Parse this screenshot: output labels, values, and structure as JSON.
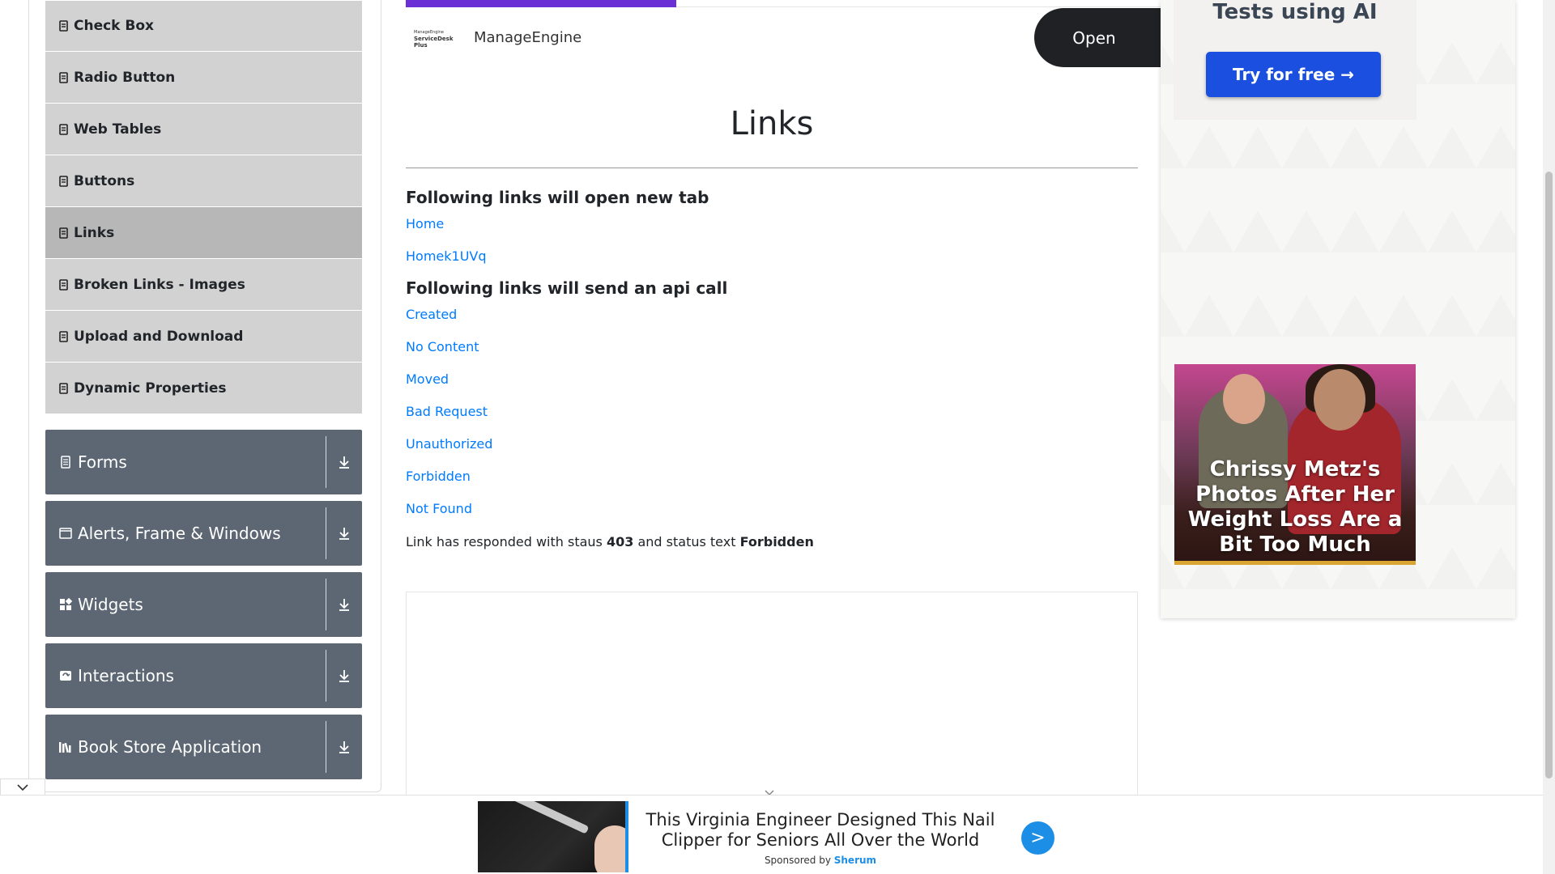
{
  "sidebar": {
    "elements_items": [
      {
        "label": "Check Box"
      },
      {
        "label": "Radio Button"
      },
      {
        "label": "Web Tables"
      },
      {
        "label": "Buttons"
      },
      {
        "label": "Links",
        "active": true
      },
      {
        "label": "Broken Links - Images"
      },
      {
        "label": "Upload and Download"
      },
      {
        "label": "Dynamic Properties"
      }
    ],
    "groups": [
      {
        "label": "Forms",
        "icon": "form-icon"
      },
      {
        "label": "Alerts, Frame & Windows",
        "icon": "window-icon"
      },
      {
        "label": "Widgets",
        "icon": "widgets-icon"
      },
      {
        "label": "Interactions",
        "icon": "interactions-icon"
      },
      {
        "label": "Book Store Application",
        "icon": "book-icon"
      }
    ]
  },
  "top_ad": {
    "logo_line1": "ManageEngine",
    "logo_line2": "ServiceDesk Plus",
    "brand": "ManageEngine",
    "open_label": "Open"
  },
  "main": {
    "title": "Links",
    "new_tab_heading": "Following links will open new tab",
    "new_tab_links": [
      "Home",
      "Homek1UVq"
    ],
    "api_heading": "Following links will send an api call",
    "api_links": [
      "Created",
      "No Content",
      "Moved",
      "Bad Request",
      "Unauthorized",
      "Forbidden",
      "Not Found"
    ],
    "response": {
      "prefix": "Link has responded with staus",
      "status_code": "403",
      "middle": "and status text",
      "status_text": "Forbidden"
    }
  },
  "right_ads": {
    "ai_headline": "Tests using AI",
    "ai_button": "Try for free →",
    "celeb_caption": "Chrissy Metz's Photos After Her Weight Loss Are a Bit Too Much"
  },
  "bottom_ad": {
    "headline": "This Virginia Engineer Designed This Nail Clipper for Seniors All Over the World",
    "sponsored_prefix": "Sponsored by",
    "sponsor": "Sherum",
    "go_label": ">"
  },
  "colors": {
    "sidebar_item_bg": "#d2d2d2",
    "sidebar_active_bg": "#b7b7b7",
    "group_bg": "#5d6673",
    "link": "#007bff",
    "ad_accent": "#1d8ee6",
    "progress": "#6b2fd6"
  }
}
